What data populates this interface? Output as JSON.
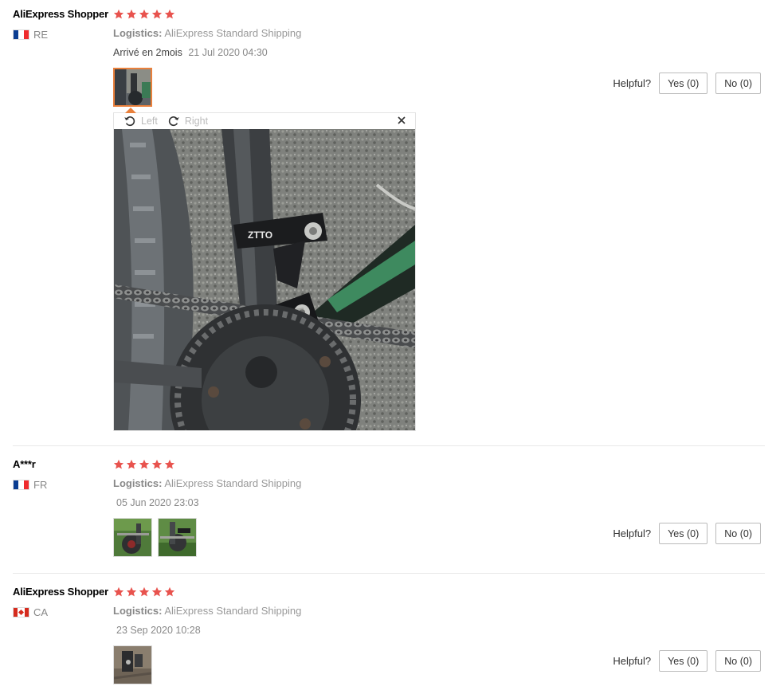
{
  "reviews": [
    {
      "user": "AliExpress Shopper",
      "country_code": "RE",
      "rating": 5,
      "logistics_label": "Logistics:",
      "logistics_value": "AliExpress Standard Shipping",
      "comment": "Arrivé en 2mois",
      "date": "21 Jul 2020 04:30",
      "helpful_label": "Helpful?",
      "yes_label": "Yes (0)",
      "no_label": "No (0)"
    },
    {
      "user": "A***r",
      "country_code": "FR",
      "rating": 5,
      "logistics_label": "Logistics:",
      "logistics_value": "AliExpress Standard Shipping",
      "comment": "",
      "date": "05 Jun 2020 23:03",
      "helpful_label": "Helpful?",
      "yes_label": "Yes (0)",
      "no_label": "No (0)"
    },
    {
      "user": "AliExpress Shopper",
      "country_code": "CA",
      "rating": 5,
      "logistics_label": "Logistics:",
      "logistics_value": "AliExpress Standard Shipping",
      "comment": "",
      "date": "23 Sep 2020 10:28",
      "helpful_label": "Helpful?",
      "yes_label": "Yes (0)",
      "no_label": "No (0)"
    }
  ],
  "viewer": {
    "rotate_left_label": "Left",
    "rotate_right_label": "Right",
    "photo_brand_text": "ZTTO"
  },
  "colors": {
    "star": "#e8534e",
    "active_thumb_border": "#e9803c",
    "flag_fr": [
      "#0a3d91",
      "#ffffff",
      "#ef2b2d"
    ],
    "flag_ca": [
      "#d52b1e",
      "#ffffff",
      "#d52b1e"
    ]
  }
}
